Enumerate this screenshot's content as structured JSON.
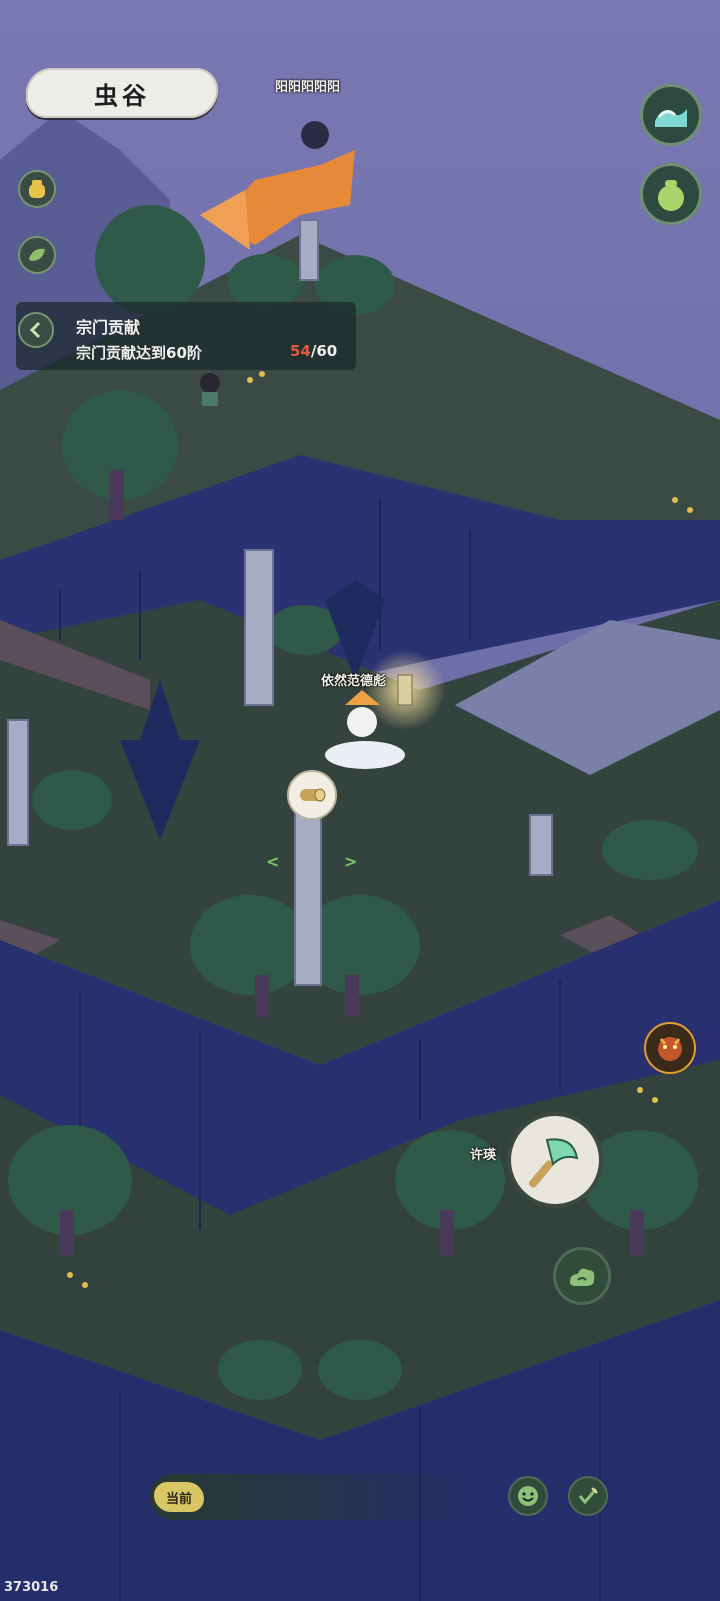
{
  "location": {
    "title": "虫谷"
  },
  "player_names": {
    "flying_player": "阳阳阳阳阳",
    "main_player": "依然范德彪",
    "npc_player": "许瑛"
  },
  "task": {
    "title": "宗门贡献",
    "description": "宗门贡献达到60阶",
    "current": "54",
    "separator": "/",
    "total": "60"
  },
  "chat": {
    "channel_label": "当前"
  },
  "footer": {
    "uid": "373016"
  },
  "icons": {
    "top_right_1": "wave-icon",
    "top_right_2": "gourd-pot-icon",
    "left_1": "honey-jar-icon",
    "left_2": "leaf-icon",
    "task_back": "chevron-left-icon",
    "interact_wood": "wood-log-icon",
    "boss": "demon-face-icon",
    "action_axe": "axe-icon",
    "action_cloud": "cloud-swirl-icon",
    "chat_emoji": "smile-icon",
    "chat_send": "feather-check-icon"
  },
  "colors": {
    "sky": "#6e6ea8",
    "grass": "#3d4a44",
    "cliff": "#2b3373",
    "progress_current": "#e25b3f",
    "button_green": "#324c3c"
  }
}
